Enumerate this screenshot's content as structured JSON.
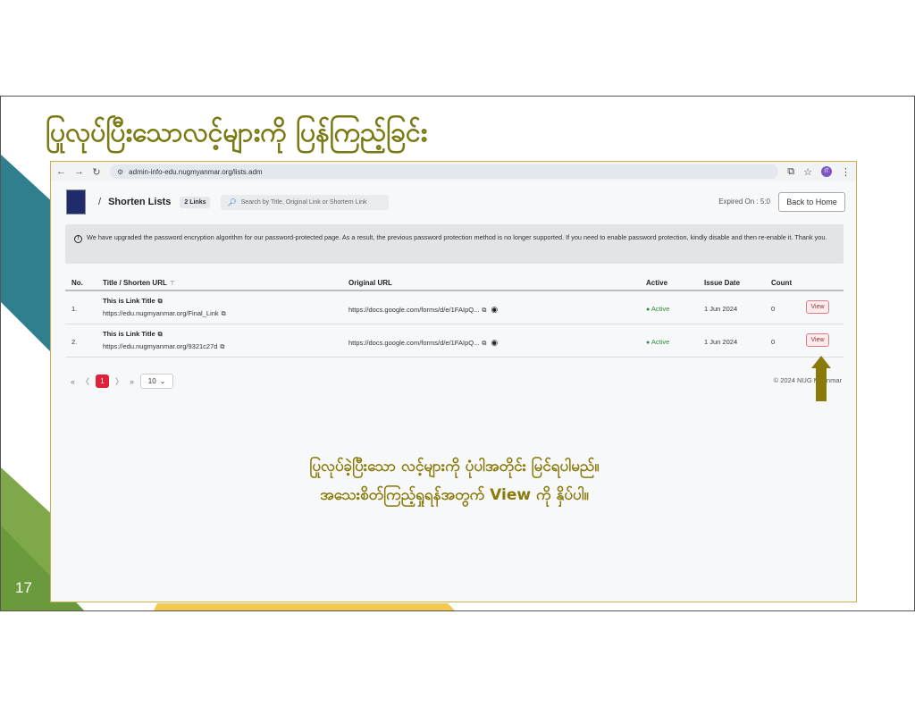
{
  "slide": {
    "title": "ပြုလုပ်ပြီးသောလင့်များကို ပြန်ကြည့်ခြင်း",
    "page_number": "17",
    "caption_line1": "ပြုလုပ်ခဲ့ပြီးသော လင့်များကို ပုံပါအတိုင်း မြင်ရပါမည်။",
    "caption_line2": "အသေးစိတ်ကြည့်ရှုရန်အတွက် View ကို နှိပ်ပါ။",
    "colors": {
      "teal": "#2f7f8f",
      "green": "#7fa84a",
      "yellow": "#f2c94c",
      "gold_text": "#8a7a0a"
    }
  },
  "browser": {
    "url": "admin-info-edu.nugmyanmar.org/lists.adm",
    "avatar_initials": "IT"
  },
  "app": {
    "breadcrumb_sep": "/",
    "page_title": "Shorten Lists",
    "links_badge": "2 Links",
    "search_placeholder": "Search by Title, Original Link or Shortern Link",
    "expired": "Expired On : 5:0",
    "back_button": "Back to Home",
    "alert_text": "We have upgraded the password encryption algorithm for our password-protected page. As a result, the previous password protection method is no longer supported. If you need to enable password protection, kindly disable and then re-enable it. Thank you.",
    "columns": {
      "no": "No.",
      "title": "Title / Shorten URL",
      "original": "Original URL",
      "active": "Active",
      "issue": "Issue Date",
      "count": "Count"
    },
    "rows": [
      {
        "no": "1.",
        "title": "This is Link Title",
        "short_url": "https://edu.nugmyanmar.org/Final_Link",
        "original": "https://docs.google.com/forms/d/e/1FAIpQ...",
        "active": "Active",
        "issue_date": "1 Jun 2024",
        "count": "0",
        "view": "View"
      },
      {
        "no": "2.",
        "title": "This is Link Title",
        "short_url": "https://edu.nugmyanmar.org/9321c27d",
        "original": "https://docs.google.com/forms/d/e/1FAIpQ...",
        "active": "Active",
        "issue_date": "1 Jun 2024",
        "count": "0",
        "view": "View"
      }
    ],
    "pagination": {
      "first": "«",
      "prev": "〈",
      "current": "1",
      "next": "〉",
      "last": "»",
      "per_page": "10"
    },
    "copyright": "© 2024 NUG Myanmar"
  }
}
